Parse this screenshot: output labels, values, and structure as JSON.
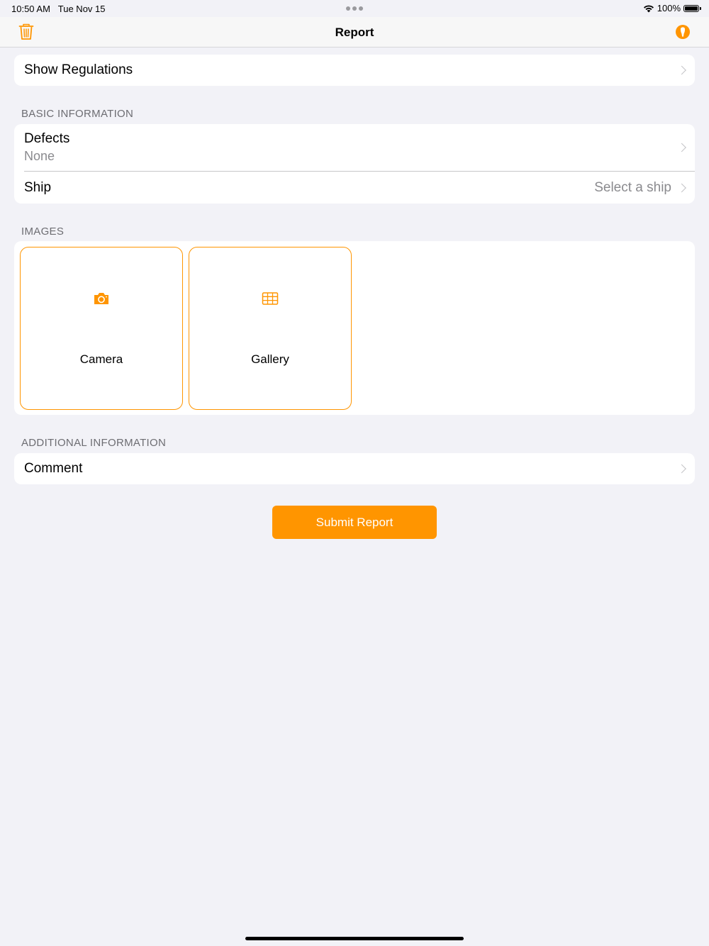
{
  "status_bar": {
    "time": "10:50 AM",
    "date": "Tue Nov 15",
    "battery": "100%"
  },
  "nav": {
    "title": "Report",
    "left_icon": "trash-icon",
    "right_icon": "info-icon"
  },
  "regulations": {
    "label": "Show Regulations"
  },
  "basic_info": {
    "header": "BASIC INFORMATION",
    "defects": {
      "label": "Defects",
      "value": "None"
    },
    "ship": {
      "label": "Ship",
      "value": "Select a ship"
    }
  },
  "images": {
    "header": "IMAGES",
    "tiles": [
      {
        "label": "Camera",
        "icon": "camera-icon"
      },
      {
        "label": "Gallery",
        "icon": "grid-icon"
      }
    ]
  },
  "additional_info": {
    "header": "ADDITIONAL INFORMATION",
    "comment": {
      "label": "Comment"
    }
  },
  "submit": {
    "label": "Submit Report"
  },
  "colors": {
    "accent": "#ff9500",
    "background": "#f2f2f7",
    "secondary_text": "#8a8a8e"
  }
}
